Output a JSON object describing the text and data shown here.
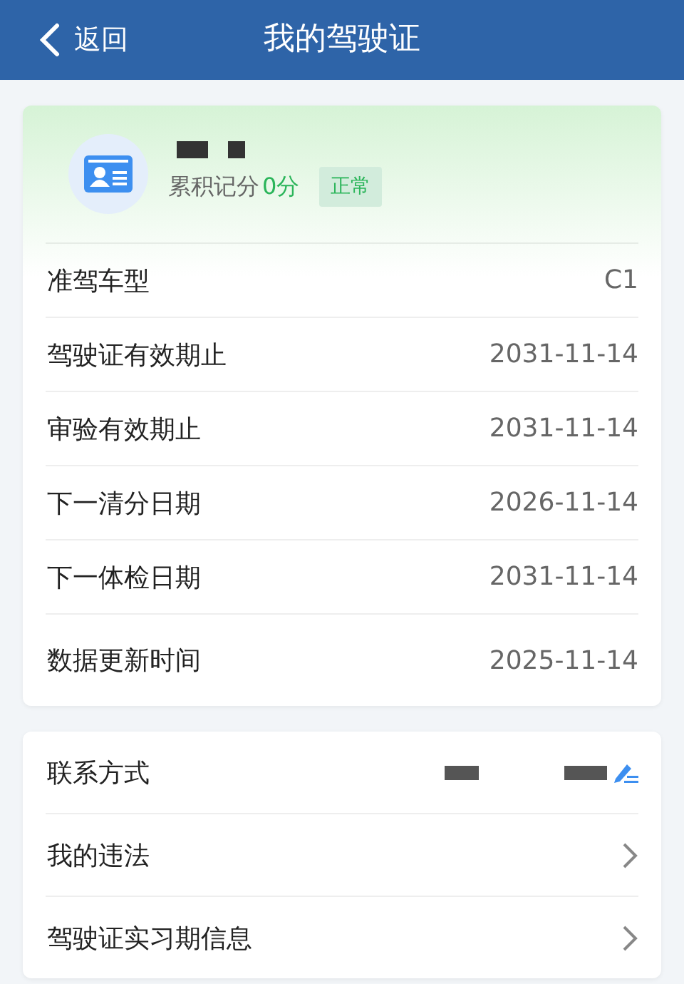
{
  "nav": {
    "back_label": "返回",
    "title": "我的驾驶证"
  },
  "license": {
    "points_label": "累积记分",
    "points": "0分",
    "status": "正常",
    "rows": [
      {
        "label": "准驾车型",
        "value": "C1"
      },
      {
        "label": "驾驶证有效期止",
        "value": "2031-11-14"
      },
      {
        "label": "审验有效期止",
        "value": "2031-11-14"
      },
      {
        "label": "下一清分日期",
        "value": "2026-11-14"
      },
      {
        "label": "下一体检日期",
        "value": "2031-11-14"
      },
      {
        "label": "数据更新时间",
        "value": "2025-11-14"
      }
    ]
  },
  "links": [
    {
      "kind": "edit",
      "label": "联系方式"
    },
    {
      "kind": "arrow",
      "label": "我的违法"
    },
    {
      "kind": "arrow",
      "label": "驾驶证实习期信息"
    }
  ]
}
